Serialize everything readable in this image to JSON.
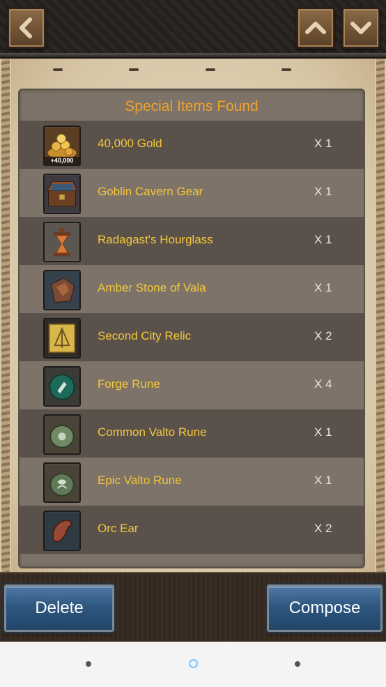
{
  "panel": {
    "title": "Special Items Found"
  },
  "items": [
    {
      "name": "40,000 Gold",
      "qty": "X 1",
      "icon": "gold-coins-icon",
      "badge": "+40,000"
    },
    {
      "name": "Goblin Cavern Gear",
      "qty": "X 1",
      "icon": "treasure-chest-icon"
    },
    {
      "name": "Radagast's Hourglass",
      "qty": "X 1",
      "icon": "hourglass-icon"
    },
    {
      "name": "Amber Stone of Vala",
      "qty": "X 1",
      "icon": "amber-stone-icon"
    },
    {
      "name": "Second City Relic",
      "qty": "X 2",
      "icon": "relic-tablet-icon"
    },
    {
      "name": "Forge Rune",
      "qty": "X 4",
      "icon": "forge-rune-icon"
    },
    {
      "name": "Common Valto Rune",
      "qty": "X 1",
      "icon": "common-valto-rune-icon"
    },
    {
      "name": "Epic Valto Rune",
      "qty": "X 1",
      "icon": "epic-valto-rune-icon"
    },
    {
      "name": "Orc Ear",
      "qty": "X 2",
      "icon": "orc-ear-icon"
    }
  ],
  "actions": {
    "delete_label": "Delete",
    "compose_label": "Compose"
  },
  "colors": {
    "title": "#f0a22a",
    "item_name": "#f4c63b",
    "button_blue": "#2e5780"
  }
}
